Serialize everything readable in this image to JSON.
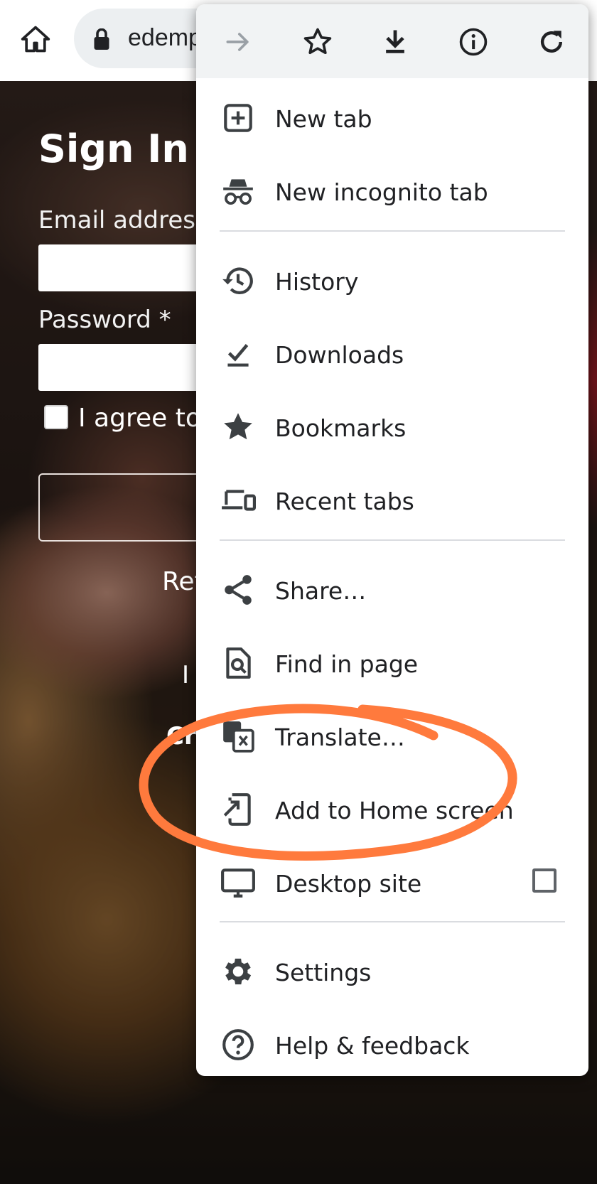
{
  "address_bar": {
    "url_text": "edemp"
  },
  "page": {
    "title": "Sign In",
    "email_label": "Email address",
    "password_label": "Password *",
    "agree_text": "I agree to t",
    "return_text": "Ret",
    "separator_text": "I",
    "create_text": "Cr"
  },
  "menu": {
    "top_icons": [
      "forward-icon",
      "bookmark-star-icon",
      "download-icon",
      "info-icon",
      "reload-icon"
    ],
    "items": [
      {
        "label": "New tab",
        "icon": "new-tab-icon"
      },
      {
        "label": "New incognito tab",
        "icon": "incognito-icon"
      },
      {
        "label": "History",
        "icon": "history-icon"
      },
      {
        "label": "Downloads",
        "icon": "downloads-icon"
      },
      {
        "label": "Bookmarks",
        "icon": "star-icon"
      },
      {
        "label": "Recent tabs",
        "icon": "devices-icon"
      },
      {
        "label": "Share…",
        "icon": "share-icon"
      },
      {
        "label": "Find in page",
        "icon": "find-in-page-icon"
      },
      {
        "label": "Translate…",
        "icon": "translate-icon"
      },
      {
        "label": "Add to Home screen",
        "icon": "add-to-home-icon"
      },
      {
        "label": "Desktop site",
        "icon": "desktop-icon",
        "checked": false
      },
      {
        "label": "Settings",
        "icon": "gear-icon"
      },
      {
        "label": "Help & feedback",
        "icon": "help-icon"
      }
    ]
  },
  "colors": {
    "menu_background": "#ffffff",
    "menu_header": "#f1f3f4",
    "icon": "#3c4043",
    "text": "#202124",
    "annotation": "#ff7a3d"
  }
}
